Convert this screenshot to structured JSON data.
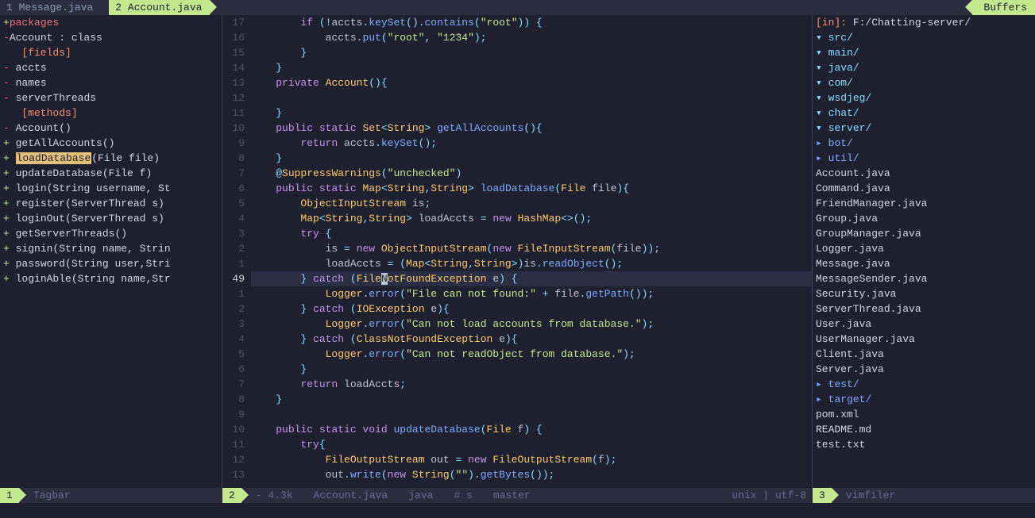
{
  "tabs": [
    {
      "label": "1 Message.java",
      "active": false
    },
    {
      "label": "2 Account.java",
      "active": true
    }
  ],
  "buffers_label": "Buffers",
  "tagbar": {
    "lines": [
      {
        "sign": "+",
        "indent": 0,
        "text": "packages",
        "cls": "c-pink"
      },
      {
        "sign": "-",
        "indent": 0,
        "text": "Account : class",
        "cls": "c-white"
      },
      {
        "sign": "",
        "indent": 2,
        "text": "[fields]",
        "cls": "c-orange"
      },
      {
        "sign": "-",
        "indent": 1,
        "text": "accts",
        "cls": "c-white"
      },
      {
        "sign": "-",
        "indent": 1,
        "text": "names",
        "cls": "c-white"
      },
      {
        "sign": "-",
        "indent": 1,
        "text": "serverThreads",
        "cls": "c-white"
      },
      {
        "sign": "",
        "indent": 2,
        "text": "[methods]",
        "cls": "c-orange"
      },
      {
        "sign": "-",
        "indent": 1,
        "text": "Account()",
        "cls": "c-white"
      },
      {
        "sign": "+",
        "indent": 1,
        "text": "getAllAccounts()",
        "cls": "c-white"
      },
      {
        "sign": "+",
        "indent": 1,
        "text_hl": "loadDatabase",
        "text_rest": "(File file)",
        "cls": "c-white"
      },
      {
        "sign": "+",
        "indent": 1,
        "text": "updateDatabase(File f)",
        "cls": "c-white"
      },
      {
        "sign": "+",
        "indent": 1,
        "text": "login(String username, St",
        "cls": "c-white"
      },
      {
        "sign": "+",
        "indent": 1,
        "text": "register(ServerThread s)",
        "cls": "c-white"
      },
      {
        "sign": "+",
        "indent": 1,
        "text": "loginOut(ServerThread s)",
        "cls": "c-white"
      },
      {
        "sign": "+",
        "indent": 1,
        "text": "getServerThreads()",
        "cls": "c-white"
      },
      {
        "sign": "+",
        "indent": 1,
        "text": "signin(String name, Strin",
        "cls": "c-white"
      },
      {
        "sign": "+",
        "indent": 1,
        "text": "password(String user,Stri",
        "cls": "c-white"
      },
      {
        "sign": "+",
        "indent": 1,
        "text": "loginAble(String name,Str",
        "cls": "c-white"
      }
    ]
  },
  "editor": {
    "lines": [
      {
        "n": "17",
        "html": "        <span class='c-purple'>if</span> <span class='c-cyan'>(!</span>accts<span class='c-cyan'>.</span><span class='c-blue'>keySet</span><span class='c-cyan'>().</span><span class='c-blue'>contains</span><span class='c-cyan'>(</span><span class='c-green'>\"root\"</span><span class='c-cyan'>)) {</span>"
      },
      {
        "n": "16",
        "html": "            accts<span class='c-cyan'>.</span><span class='c-blue'>put</span><span class='c-cyan'>(</span><span class='c-green'>\"root\"</span><span class='c-cyan'>,</span> <span class='c-green'>\"1234\"</span><span class='c-cyan'>);</span>"
      },
      {
        "n": "15",
        "html": "        <span class='c-cyan'>}</span>"
      },
      {
        "n": "14",
        "html": "    <span class='c-cyan'>}</span>"
      },
      {
        "n": "13",
        "html": "    <span class='c-purple'>private</span> <span class='c-yellow'>Account</span><span class='c-cyan'>(){</span>"
      },
      {
        "n": "12",
        "html": ""
      },
      {
        "n": "11",
        "html": "    <span class='c-cyan'>}</span>"
      },
      {
        "n": "10",
        "html": "    <span class='c-purple'>public static</span> <span class='c-yellow'>Set</span><span class='c-cyan'>&lt;</span><span class='c-yellow'>String</span><span class='c-cyan'>&gt;</span> <span class='c-blue'>getAllAccounts</span><span class='c-cyan'>(){</span>"
      },
      {
        "n": "9",
        "html": "        <span class='c-purple'>return</span> accts<span class='c-cyan'>.</span><span class='c-blue'>keySet</span><span class='c-cyan'>();</span>"
      },
      {
        "n": "8",
        "html": "    <span class='c-cyan'>}</span>"
      },
      {
        "n": "7",
        "html": "    <span class='c-cyan'>@</span><span class='c-yellow'>SuppressWarnings</span><span class='c-cyan'>(</span><span class='c-green'>\"unchecked\"</span><span class='c-cyan'>)</span>"
      },
      {
        "n": "6",
        "html": "    <span class='c-purple'>public static</span> <span class='c-yellow'>Map</span><span class='c-cyan'>&lt;</span><span class='c-yellow'>String</span><span class='c-cyan'>,</span><span class='c-yellow'>String</span><span class='c-cyan'>&gt;</span> <span class='c-blue'>loadDatabase</span><span class='c-cyan'>(</span><span class='c-yellow'>File</span> file<span class='c-cyan'>){</span>"
      },
      {
        "n": "5",
        "html": "        <span class='c-yellow'>ObjectInputStream</span> is<span class='c-cyan'>;</span>"
      },
      {
        "n": "4",
        "html": "        <span class='c-yellow'>Map</span><span class='c-cyan'>&lt;</span><span class='c-yellow'>String</span><span class='c-cyan'>,</span><span class='c-yellow'>String</span><span class='c-cyan'>&gt;</span> loadAccts <span class='c-cyan'>=</span> <span class='c-purple'>new</span> <span class='c-yellow'>HashMap</span><span class='c-cyan'>&lt;&gt;();</span>"
      },
      {
        "n": "3",
        "html": "        <span class='c-purple'>try</span> <span class='c-cyan'>{</span>"
      },
      {
        "n": "2",
        "html": "            is <span class='c-cyan'>=</span> <span class='c-purple'>new</span> <span class='c-yellow'>ObjectInputStream</span><span class='c-cyan'>(</span><span class='c-purple'>new</span> <span class='c-yellow'>FileInputStream</span><span class='c-cyan'>(</span>file<span class='c-cyan'>));</span>"
      },
      {
        "n": "1",
        "html": "            loadAccts <span class='c-cyan'>= (</span><span class='c-yellow'>Map</span><span class='c-cyan'>&lt;</span><span class='c-yellow'>String</span><span class='c-cyan'>,</span><span class='c-yellow'>String</span><span class='c-cyan'>&gt;)</span>is<span class='c-cyan'>.</span><span class='c-blue'>readObject</span><span class='c-cyan'>();</span>"
      },
      {
        "n": "49",
        "current": true,
        "html": "        <span class='c-cyan'>}</span> <span class='c-purple'>catch</span> <span class='c-cyan'>(</span><span class='c-yellow'>File<span class='cursor'>N</span>otFoundException</span> e<span class='c-cyan'>) {</span>"
      },
      {
        "n": "1",
        "html": "            <span class='c-yellow'>Logger</span><span class='c-cyan'>.</span><span class='c-blue'>error</span><span class='c-cyan'>(</span><span class='c-green'>\"File can not found:\"</span> <span class='c-cyan'>+</span> file<span class='c-cyan'>.</span><span class='c-blue'>getPath</span><span class='c-cyan'>());</span>"
      },
      {
        "n": "2",
        "html": "        <span class='c-cyan'>}</span> <span class='c-purple'>catch</span> <span class='c-cyan'>(</span><span class='c-yellow'>IOException</span> e<span class='c-cyan'>){</span>"
      },
      {
        "n": "3",
        "html": "            <span class='c-yellow'>Logger</span><span class='c-cyan'>.</span><span class='c-blue'>error</span><span class='c-cyan'>(</span><span class='c-green'>\"Can not load accounts from database.\"</span><span class='c-cyan'>);</span>"
      },
      {
        "n": "4",
        "html": "        <span class='c-cyan'>}</span> <span class='c-purple'>catch</span> <span class='c-cyan'>(</span><span class='c-yellow'>ClassNotFoundException</span> e<span class='c-cyan'>){</span>"
      },
      {
        "n": "5",
        "html": "            <span class='c-yellow'>Logger</span><span class='c-cyan'>.</span><span class='c-blue'>error</span><span class='c-cyan'>(</span><span class='c-green'>\"Can not readObject from database.\"</span><span class='c-cyan'>);</span>"
      },
      {
        "n": "6",
        "html": "        <span class='c-cyan'>}</span>"
      },
      {
        "n": "7",
        "html": "        <span class='c-purple'>return</span> loadAccts<span class='c-cyan'>;</span>"
      },
      {
        "n": "8",
        "html": "    <span class='c-cyan'>}</span>"
      },
      {
        "n": "9",
        "html": ""
      },
      {
        "n": "10",
        "html": "    <span class='c-purple'>public static void</span> <span class='c-blue'>updateDatabase</span><span class='c-cyan'>(</span><span class='c-yellow'>File</span> f<span class='c-cyan'>) {</span>"
      },
      {
        "n": "11",
        "html": "        <span class='c-purple'>try</span><span class='c-cyan'>{</span>"
      },
      {
        "n": "12",
        "html": "            <span class='c-yellow'>FileOutputStream</span> out <span class='c-cyan'>=</span> <span class='c-purple'>new</span> <span class='c-yellow'>FileOutputStream</span><span class='c-cyan'>(</span>f<span class='c-cyan'>);</span>"
      },
      {
        "n": "13",
        "html": "            out<span class='c-cyan'>.</span><span class='c-blue'>write</span><span class='c-cyan'>(</span><span class='c-purple'>new</span> <span class='c-yellow'>String</span><span class='c-cyan'>(</span><span class='c-green'>\"\"</span><span class='c-cyan'>).</span><span class='c-blue'>getBytes</span><span class='c-cyan'>());</span>"
      }
    ]
  },
  "filer": {
    "header_label": "[in]:",
    "header_path": "F:/Chatting-server/",
    "tree": [
      {
        "d": 0,
        "type": "dopen",
        "name": "src/"
      },
      {
        "d": 1,
        "type": "dopen",
        "name": "main/"
      },
      {
        "d": 2,
        "type": "dopen",
        "name": "java/"
      },
      {
        "d": 3,
        "type": "dopen",
        "name": "com/"
      },
      {
        "d": 4,
        "type": "dopen",
        "name": "wsdjeg/"
      },
      {
        "d": 5,
        "type": "dopen",
        "name": "chat/"
      },
      {
        "d": 6,
        "type": "dopen",
        "name": "server/"
      },
      {
        "d": 7,
        "type": "dclosed",
        "name": "bot/"
      },
      {
        "d": 7,
        "type": "dclosed",
        "name": "util/"
      },
      {
        "d": 7,
        "type": "file",
        "name": "Account.java"
      },
      {
        "d": 7,
        "type": "file",
        "name": "Command.java"
      },
      {
        "d": 7,
        "type": "file",
        "name": "FriendManager.java"
      },
      {
        "d": 7,
        "type": "file",
        "name": "Group.java"
      },
      {
        "d": 7,
        "type": "file",
        "name": "GroupManager.java"
      },
      {
        "d": 7,
        "type": "file",
        "name": "Logger.java"
      },
      {
        "d": 7,
        "type": "file",
        "name": "Message.java"
      },
      {
        "d": 7,
        "type": "file",
        "name": "MessageSender.java"
      },
      {
        "d": 7,
        "type": "file",
        "name": "Security.java"
      },
      {
        "d": 7,
        "type": "file",
        "name": "ServerThread.java"
      },
      {
        "d": 7,
        "type": "file",
        "name": "User.java"
      },
      {
        "d": 7,
        "type": "file",
        "name": "UserManager.java"
      },
      {
        "d": 6,
        "type": "file",
        "name": "Client.java"
      },
      {
        "d": 6,
        "type": "file",
        "name": "Server.java"
      },
      {
        "d": 1,
        "type": "dclosed",
        "name": "test/"
      },
      {
        "d": 0,
        "type": "dclosed",
        "name": "target/"
      },
      {
        "d": 0,
        "type": "file",
        "name": "pom.xml"
      },
      {
        "d": 0,
        "type": "file",
        "name": "README.md"
      },
      {
        "d": 0,
        "type": "file",
        "name": "test.txt"
      }
    ]
  },
  "status": {
    "p1": {
      "num": "1",
      "name": "Tagbar"
    },
    "p2": {
      "num": "2",
      "size": "- 4.3k",
      "file": "Account.java",
      "ft": "java",
      "sec": "# s",
      "branch": "master",
      "enc": "unix | utf-8"
    },
    "p3": {
      "num": "3",
      "name": "vimfiler"
    }
  }
}
